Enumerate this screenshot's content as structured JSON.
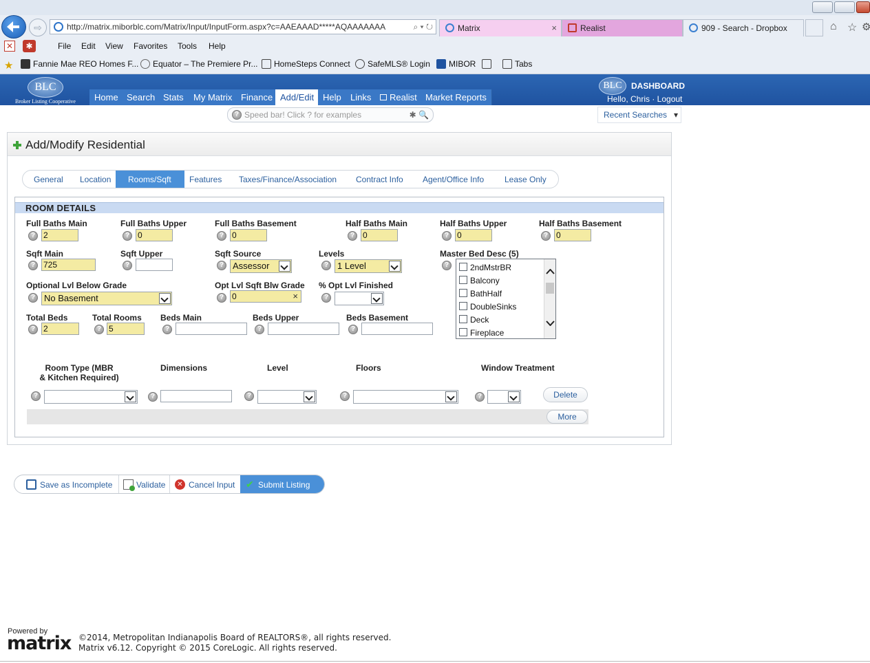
{
  "browser": {
    "url": "http://matrix.miborblc.com/Matrix/Input/InputForm.aspx?c=AAEAAAD*****AQAAAAAAA",
    "url_tools": "⌕ ▾ ↻",
    "tabs": [
      {
        "label": "Matrix",
        "close": "×"
      },
      {
        "label": "Realist"
      },
      {
        "label": "909 - Search - Dropbox"
      }
    ],
    "menu": [
      "File",
      "Edit",
      "View",
      "Favorites",
      "Tools",
      "Help"
    ],
    "favorites": [
      "Fannie Mae REO Homes F...",
      "Equator – The Premiere Pr...",
      "HomeSteps Connect",
      "SafeMLS® Login",
      "MIBOR",
      "Tabs"
    ],
    "fwd_glyph": "⇨"
  },
  "site": {
    "logo_text": "BLC",
    "logo_sub": "Broker Listing Cooperative",
    "nav": [
      "Home",
      "Search",
      "Stats",
      "My Matrix",
      "Finance",
      "Add/Edit",
      "Help",
      "Links",
      "Realist",
      "Market Reports"
    ],
    "nav_active": "Add/Edit",
    "dashboard_logo": "BLC",
    "dashboard_label": "DASHBOARD",
    "greeting": "Hello, Chris · Logout",
    "speedbar_placeholder": "Speed bar! Click ? for examples",
    "recent_searches": "Recent Searches",
    "help_glyph": "?",
    "speed_icons": "✱ 🔍",
    "dropdown_glyph": "▾"
  },
  "panel": {
    "title": "Add/Modify Residential",
    "tabs": [
      "General",
      "Location",
      "Rooms/Sqft",
      "Features",
      "Taxes/Finance/Association",
      "Contract Info",
      "Agent/Office Info",
      "Lease Only"
    ],
    "active_tab": "Rooms/Sqft",
    "section_title": "ROOM DETAILS",
    "fields": {
      "full_baths_main": {
        "label": "Full Baths Main",
        "value": "2"
      },
      "full_baths_upper": {
        "label": "Full Baths Upper",
        "value": "0"
      },
      "full_baths_basement": {
        "label": "Full Baths Basement",
        "value": "0"
      },
      "half_baths_main": {
        "label": "Half Baths Main",
        "value": "0"
      },
      "half_baths_upper": {
        "label": "Half Baths Upper",
        "value": "0"
      },
      "half_baths_basement": {
        "label": "Half Baths Basement",
        "value": "0"
      },
      "sqft_main": {
        "label": "Sqft Main",
        "value": "725"
      },
      "sqft_upper": {
        "label": "Sqft Upper",
        "value": ""
      },
      "sqft_source": {
        "label": "Sqft Source",
        "value": "Assessor"
      },
      "levels": {
        "label": "Levels",
        "value": "1 Level"
      },
      "master_bed_desc": {
        "label": "Master Bed Desc (5)"
      },
      "optional_lvl": {
        "label": "Optional Lvl Below Grade",
        "value": "No Basement"
      },
      "opt_lvl_sqft": {
        "label": "Opt Lvl Sqft Blw Grade",
        "value": "0",
        "clear": "×"
      },
      "pct_opt_lvl": {
        "label": "% Opt Lvl Finished",
        "value": ""
      },
      "total_beds": {
        "label": "Total Beds",
        "value": "2"
      },
      "total_rooms": {
        "label": "Total Rooms",
        "value": "5"
      },
      "beds_main": {
        "label": "Beds Main",
        "value": ""
      },
      "beds_upper": {
        "label": "Beds Upper",
        "value": ""
      },
      "beds_basement": {
        "label": "Beds Basement",
        "value": ""
      }
    },
    "master_bed_options": [
      "2ndMstrBR",
      "Balcony",
      "BathHalf",
      "DoubleSinks",
      "Deck",
      "Fireplace"
    ],
    "room_columns": {
      "room_type_line1": "Room Type (MBR",
      "room_type_line2": "& Kitchen Required)",
      "dimensions": "Dimensions",
      "level": "Level",
      "floors": "Floors",
      "window_treatment": "Window Treatment"
    },
    "delete_label": "Delete",
    "more_label": "More"
  },
  "actions": {
    "save_incomplete": "Save as Incomplete",
    "validate": "Validate",
    "cancel": "Cancel Input",
    "submit": "Submit Listing"
  },
  "footer": {
    "powered_by": "Powered by",
    "brand": "matrix",
    "copyright1": "©2014, Metropolitan Indianapolis Board of REALTORS®, all rights reserved.",
    "copyright2": "Matrix v6.12. Copyright © 2015 CoreLogic. All rights reserved."
  },
  "colors": {
    "header_blue": "#1f53a0",
    "required_yellow": "#f4eba3",
    "active_tab_blue": "#4a90d8",
    "section_blue": "#c9daf2"
  }
}
